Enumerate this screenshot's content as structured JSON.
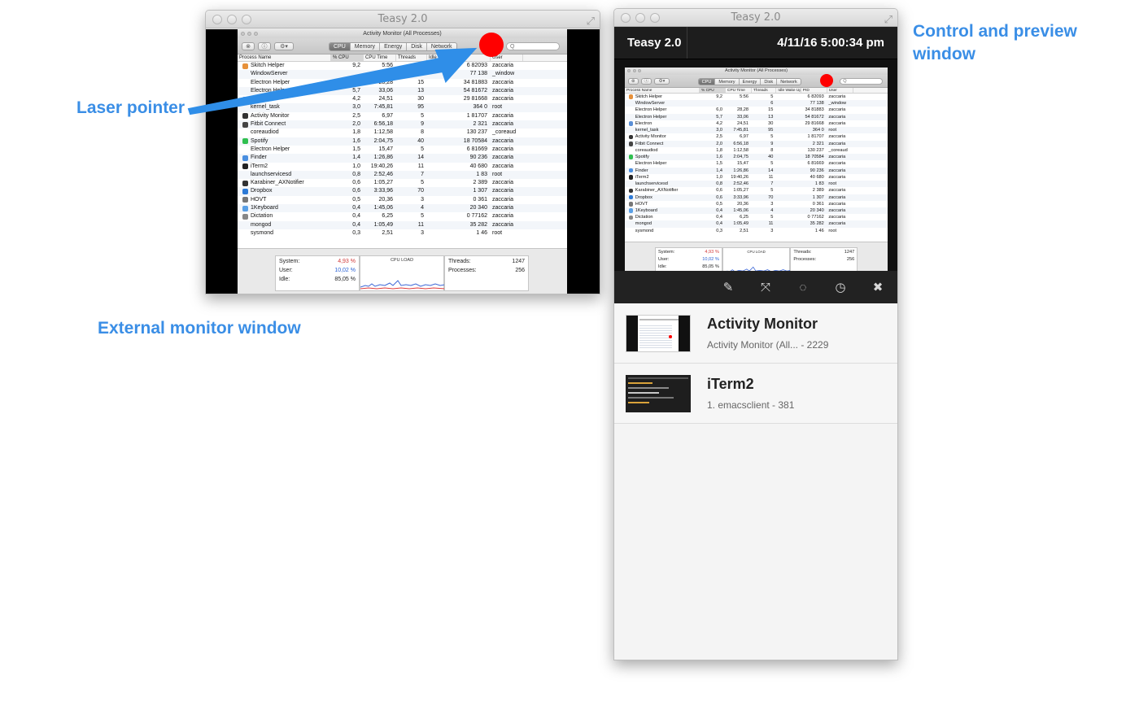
{
  "callouts": {
    "laser": "Laser pointer",
    "external": "External monitor window",
    "control": "Control and preview window"
  },
  "colors": {
    "callout": "#3a8ee6",
    "laser_dot": "#ff0000",
    "arrow": "#2f8ee8"
  },
  "external_window": {
    "title": "Teasy 2.0"
  },
  "control_window": {
    "title": "Teasy 2.0",
    "app_label": "Teasy 2.0",
    "datetime": "4/11/16 5:00:34 pm",
    "tools": [
      {
        "icon": "eyedropper-icon",
        "glyph": "✎"
      },
      {
        "icon": "expand-icon",
        "glyph": "⤧"
      },
      {
        "icon": "spinner-icon",
        "glyph": "◌"
      },
      {
        "icon": "timer-icon",
        "glyph": "◷"
      },
      {
        "icon": "close-icon",
        "glyph": "✖"
      }
    ],
    "items": [
      {
        "title": "Activity Monitor",
        "subtitle": "Activity Monitor (All...  - 2229"
      },
      {
        "title": "iTerm2",
        "subtitle": "1. emacsclient  - 381"
      }
    ]
  },
  "activity_monitor": {
    "title": "Activity Monitor (All Processes)",
    "tabs": [
      "CPU",
      "Memory",
      "Energy",
      "Disk",
      "Network"
    ],
    "active_tab": "CPU",
    "search_placeholder": "Q",
    "columns": [
      "Process Name",
      "% CPU",
      "CPU Time",
      "Threads",
      "Idle Wake Ups",
      "PID",
      "User"
    ],
    "rows": [
      {
        "name": "Skitch Helper",
        "cpu": "9,2",
        "time": "5:56",
        "threads": "5",
        "idle": "",
        "pid": "6 82093",
        "user": "zaccaria",
        "icon": "#e7913a"
      },
      {
        "name": "WindowServer",
        "cpu": "",
        "time": "",
        "threads": "6",
        "idle": "",
        "pid": "77  138",
        "user": "_window",
        "icon": ""
      },
      {
        "name": "Electron Helper",
        "cpu": "6,0",
        "time": "28,28",
        "threads": "15",
        "idle": "",
        "pid": "34 81883",
        "user": "zaccaria",
        "icon": ""
      },
      {
        "name": "Electron Helper",
        "cpu": "5,7",
        "time": "33,06",
        "threads": "13",
        "idle": "",
        "pid": "54 81672",
        "user": "zaccaria",
        "icon": ""
      },
      {
        "name": "Electron",
        "cpu": "4,2",
        "time": "24,51",
        "threads": "30",
        "idle": "",
        "pid": "29 81668",
        "user": "zaccaria",
        "icon": "#5a8fd6"
      },
      {
        "name": "kernel_task",
        "cpu": "3,0",
        "time": "7:45,81",
        "threads": "95",
        "idle": "",
        "pid": "364     0",
        "user": "root",
        "icon": ""
      },
      {
        "name": "Activity Monitor",
        "cpu": "2,5",
        "time": "6,97",
        "threads": "5",
        "idle": "",
        "pid": "1 81707",
        "user": "zaccaria",
        "icon": "#333333"
      },
      {
        "name": "Fitbit Connect",
        "cpu": "2,0",
        "time": "6:56,18",
        "threads": "9",
        "idle": "",
        "pid": "2    321",
        "user": "zaccaria",
        "icon": "#444444"
      },
      {
        "name": "coreaudiod",
        "cpu": "1,8",
        "time": "1:12,58",
        "threads": "8",
        "idle": "",
        "pid": "130  237",
        "user": "_coreaud",
        "icon": ""
      },
      {
        "name": "Spotify",
        "cpu": "1,6",
        "time": "2:04,75",
        "threads": "40",
        "idle": "",
        "pid": "18 70584",
        "user": "zaccaria",
        "icon": "#2fbf4f"
      },
      {
        "name": "Electron Helper",
        "cpu": "1,5",
        "time": "15,47",
        "threads": "5",
        "idle": "",
        "pid": "6 81669",
        "user": "zaccaria",
        "icon": ""
      },
      {
        "name": "Finder",
        "cpu": "1,4",
        "time": "1:26,86",
        "threads": "14",
        "idle": "",
        "pid": "90  236",
        "user": "zaccaria",
        "icon": "#4a8fe0"
      },
      {
        "name": "iTerm2",
        "cpu": "1,0",
        "time": "19:40,26",
        "threads": "11",
        "idle": "",
        "pid": "40  680",
        "user": "zaccaria",
        "icon": "#222222"
      },
      {
        "name": "launchservicesd",
        "cpu": "0,8",
        "time": "2:52,46",
        "threads": "7",
        "idle": "",
        "pid": "1    83",
        "user": "root",
        "icon": ""
      },
      {
        "name": "Karabiner_AXNotifier",
        "cpu": "0,6",
        "time": "1:05,27",
        "threads": "5",
        "idle": "",
        "pid": "2  389",
        "user": "zaccaria",
        "icon": "#333333"
      },
      {
        "name": "Dropbox",
        "cpu": "0,6",
        "time": "3:33,96",
        "threads": "70",
        "idle": "",
        "pid": "1  307",
        "user": "zaccaria",
        "icon": "#2d7ad6"
      },
      {
        "name": "HOVT",
        "cpu": "0,5",
        "time": "20,36",
        "threads": "3",
        "idle": "",
        "pid": "0  361",
        "user": "zaccaria",
        "icon": "#777777"
      },
      {
        "name": "1Keyboard",
        "cpu": "0,4",
        "time": "1:45,06",
        "threads": "4",
        "idle": "",
        "pid": "20  340",
        "user": "zaccaria",
        "icon": "#5aa0e6"
      },
      {
        "name": "Dictation",
        "cpu": "0,4",
        "time": "6,25",
        "threads": "5",
        "idle": "",
        "pid": "0 77162",
        "user": "zaccaria",
        "icon": "#888888"
      },
      {
        "name": "mongod",
        "cpu": "0,4",
        "time": "1:05,49",
        "threads": "11",
        "idle": "",
        "pid": "35  282",
        "user": "zaccaria",
        "icon": ""
      },
      {
        "name": "sysmond",
        "cpu": "0,3",
        "time": "2,51",
        "threads": "3",
        "idle": "",
        "pid": "1    46",
        "user": "root",
        "icon": ""
      }
    ],
    "stats": {
      "system_label": "System:",
      "system_value": "4,93 %",
      "user_label": "User:",
      "user_value": "10,02 %",
      "idle_label": "Idle:",
      "idle_value": "85,05 %",
      "cpu_load_label": "CPU LOAD",
      "threads_label": "Threads:",
      "threads_value": "1247",
      "processes_label": "Processes:",
      "processes_value": "256"
    }
  }
}
